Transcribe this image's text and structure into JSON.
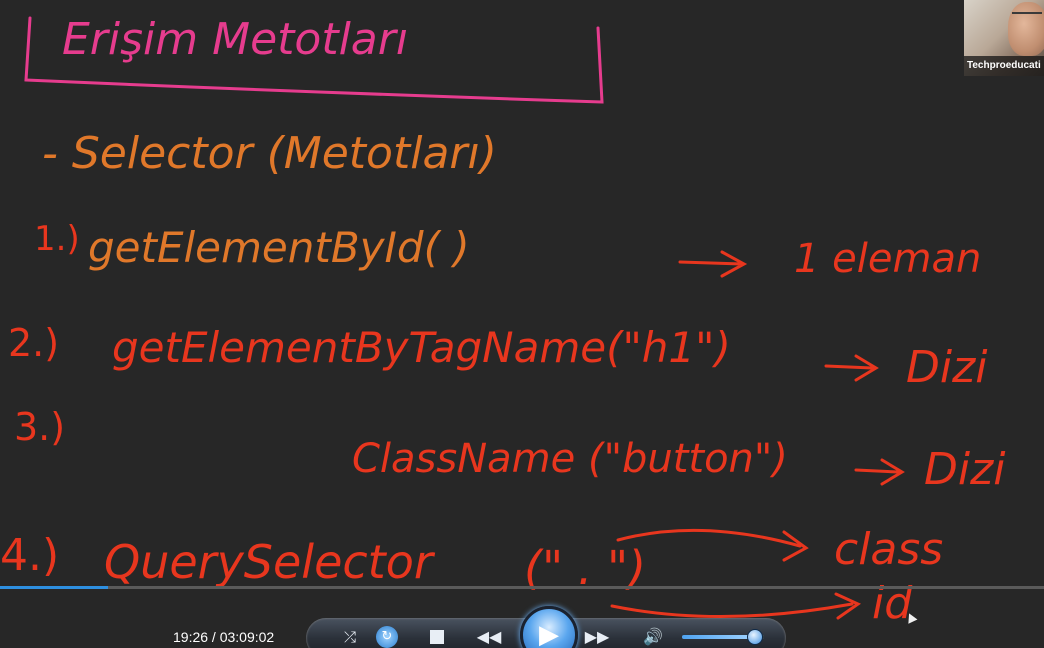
{
  "whiteboard": {
    "title": "Erişim Metotları",
    "line_selector": "- Selector (Metotları)",
    "item1_num": "1.)",
    "item1_code": "getElementById(   )",
    "item1_result": "1 eleman",
    "item2_num": "2.)",
    "item2_code": "getElementByTagName(\"h1\")",
    "item2_result": "Dizi",
    "item3_num": "3.)",
    "item3_code": "ClassName (\"button\")",
    "item3_result": "Dizi",
    "item4_num": "4.)",
    "item4_code": "QuerySelector",
    "item4_paren": "(\"   .   \")",
    "item4_class": "class",
    "item4_id": "id",
    "colors": {
      "title": "#e63c8e",
      "orange": "#e0782a",
      "red": "#e8361e"
    }
  },
  "webcam": {
    "caption": "Techproeducati"
  },
  "player": {
    "timecode": "19:26 / 03:09:02",
    "progress_fraction": 0.103,
    "volume_fraction": 0.88,
    "icons": {
      "shuffle": "shuffle-icon",
      "repeat": "repeat-icon",
      "stop": "stop-icon",
      "previous": "rewind-icon",
      "play": "play-icon",
      "next": "fast-forward-icon",
      "volume": "volume-icon"
    }
  }
}
